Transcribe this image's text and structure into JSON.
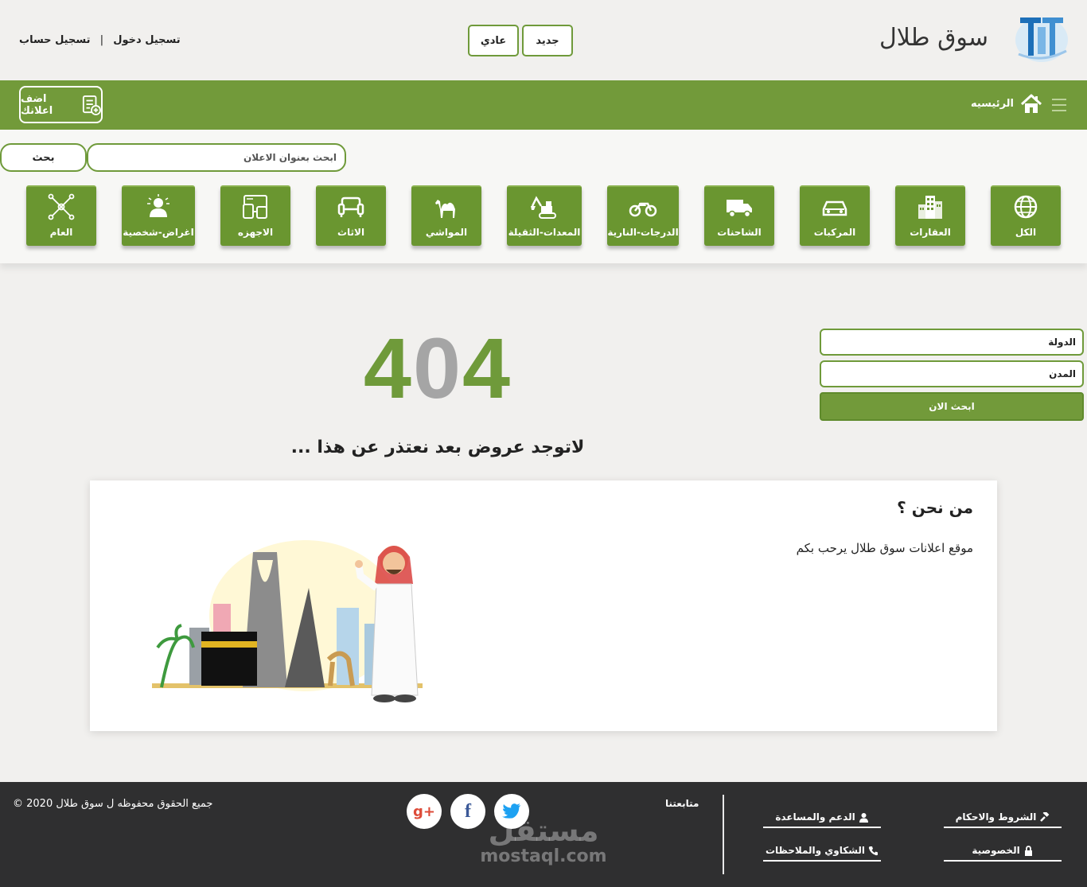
{
  "header": {
    "site_title": "سوق طلال",
    "condition_new": "جديد",
    "condition_normal": "عادي",
    "login": "تسجيل دخول",
    "separator": "|",
    "register": "تسجيل حساب"
  },
  "nav": {
    "home": "الرئيسيه",
    "add_ad": "اضف اعلانك"
  },
  "search": {
    "placeholder": "ابحث بعنوان الاعلان",
    "button": "بحث"
  },
  "categories": [
    {
      "label": "الكل",
      "icon": "globe-icon"
    },
    {
      "label": "العقارات",
      "icon": "buildings-icon"
    },
    {
      "label": "المركبات",
      "icon": "car-icon"
    },
    {
      "label": "الشاحنات",
      "icon": "truck-icon"
    },
    {
      "label": "الدرجات-النارية",
      "icon": "motorcycle-icon"
    },
    {
      "label": "المعدات-الثقيلة",
      "icon": "excavator-icon"
    },
    {
      "label": "المواشي",
      "icon": "camel-icon"
    },
    {
      "label": "الاثاث",
      "icon": "sofa-icon"
    },
    {
      "label": "الاجهزه",
      "icon": "devices-icon"
    },
    {
      "label": "اغراض-شخصية",
      "icon": "person-icon"
    },
    {
      "label": "العام",
      "icon": "network-icon"
    }
  ],
  "error": {
    "code_part1": "4",
    "code_part2": "0",
    "code_part3": "4",
    "message": "لاتوجد عروض بعد نعتذر عن هذا ..."
  },
  "filter": {
    "country_placeholder": "الدولة",
    "city_placeholder": "المدن",
    "search_now": "ابحث الان"
  },
  "about": {
    "title": "من نحن ؟",
    "text": "موقع اعلانات سوق طلال يرحب بكم"
  },
  "footer": {
    "copyright": "جميع الحقوق محفوظه ل سوق طلال 2020 ©",
    "follow_us": "متابعتنا",
    "terms": "الشروط والاحكام",
    "support": "الدعم والمساعدة",
    "privacy": "الخصوصية",
    "complaints": "الشكاوي والملاحظات",
    "watermark_ar": "مستقل",
    "watermark_en": "mostaql.com"
  },
  "colors": {
    "primary_green": "#729a3a",
    "dark_footer": "#2f2f30",
    "twitter": "#1da1f2",
    "facebook": "#3b5998",
    "google_plus": "#dd4b39"
  }
}
